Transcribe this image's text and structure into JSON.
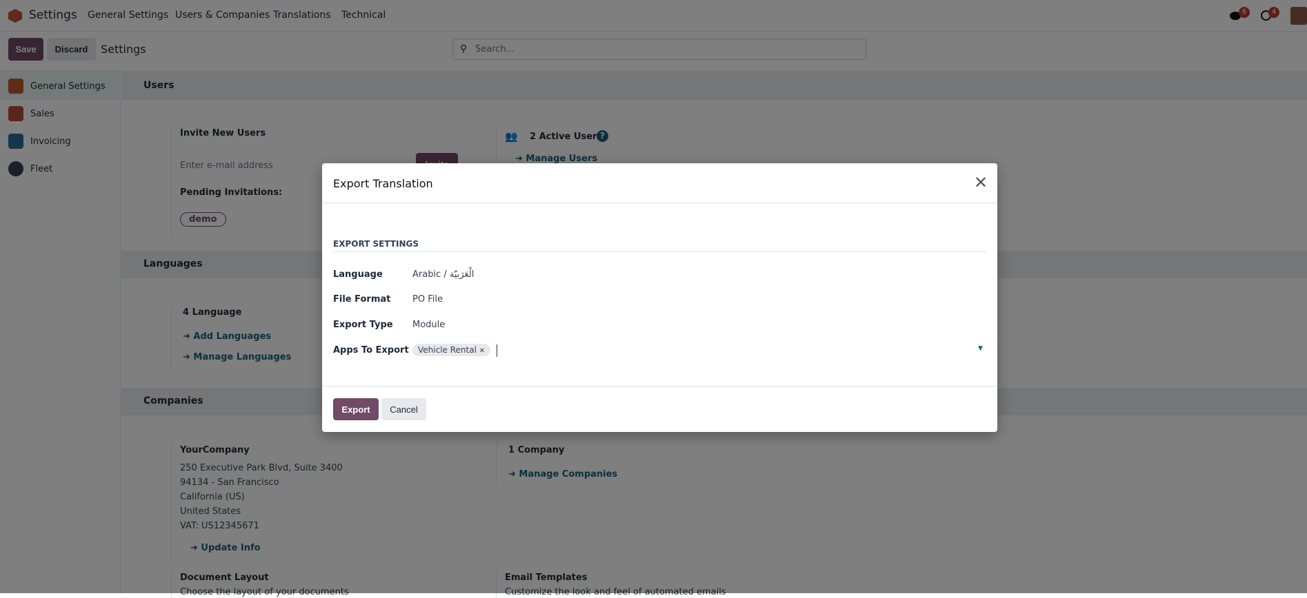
{
  "navbar": {
    "app_title": "Settings",
    "menu": [
      "General Settings",
      "Users & Companies",
      "Translations",
      "Technical"
    ],
    "messages_count": "6",
    "activities_count": "4"
  },
  "control_panel": {
    "save": "Save",
    "discard": "Discard",
    "breadcrumb": "Settings",
    "search_placeholder": "Search..."
  },
  "sidebar": {
    "items": [
      {
        "label": "General Settings",
        "icon": "settings-app-icon",
        "color": "#c0562f"
      },
      {
        "label": "Sales",
        "icon": "sales-app-icon",
        "color": "#b34d3a"
      },
      {
        "label": "Invoicing",
        "icon": "invoicing-app-icon",
        "color": "#2a6f9b"
      },
      {
        "label": "Fleet",
        "icon": "fleet-app-icon",
        "color": "#374151"
      }
    ]
  },
  "users": {
    "header": "Users",
    "invite_title": "Invite New Users",
    "email_placeholder": "Enter e-mail address",
    "invite_button": "Invite",
    "pending_label": "Pending Invitations:",
    "pending_tag": "demo",
    "active_users": "2 Active User",
    "manage_users": "Manage Users"
  },
  "languages": {
    "header": "Languages",
    "count": "4 Language",
    "add": "Add Languages",
    "manage": "Manage Languages"
  },
  "companies": {
    "header": "Companies",
    "name": "YourCompany",
    "address": [
      "250 Executive Park Blvd, Suite 3400",
      "94134 - San Francisco",
      "California (US)",
      "United States",
      "VAT:  US12345671"
    ],
    "update_info": "Update Info",
    "count": "1 Company",
    "manage": "Manage Companies",
    "document_layout": "Document Layout",
    "document_layout_desc": "Choose the layout of your documents",
    "email_templates": "Email Templates",
    "email_templates_desc": "Customize the look and feel of automated emails"
  },
  "modal": {
    "title": "Export Translation",
    "section": "EXPORT SETTINGS",
    "fields": [
      {
        "label": "Language",
        "value": "Arabic / الْعَرَبيّة"
      },
      {
        "label": "File Format",
        "value": "PO File"
      },
      {
        "label": "Export Type",
        "value": "Module"
      },
      {
        "label": "Apps To Export",
        "value": ""
      }
    ],
    "apps_tag": "Vehicle Rental",
    "export": "Export",
    "cancel": "Cancel"
  },
  "colors": {
    "primary": "#714b67",
    "link": "#1a5f7a",
    "badge": "#c0392b"
  }
}
